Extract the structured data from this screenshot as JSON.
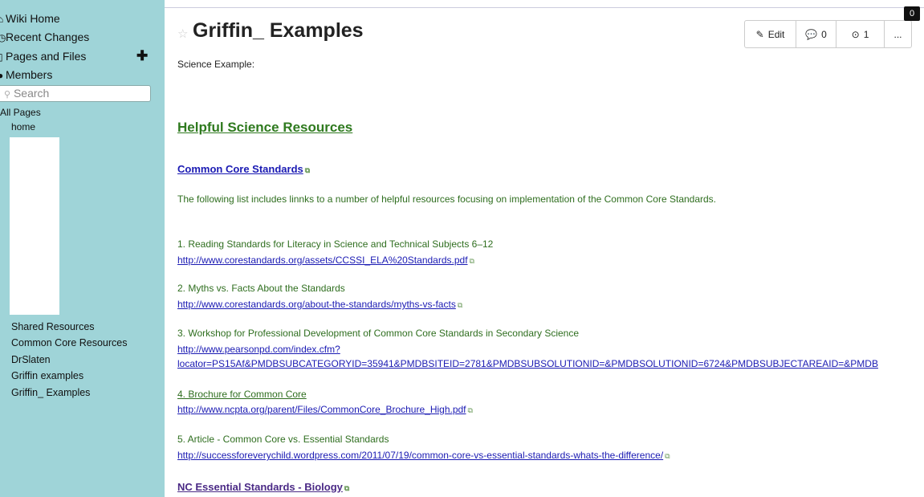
{
  "sidebar": {
    "nav": [
      {
        "label": "Wiki Home",
        "icon": "home-icon"
      },
      {
        "label": "Recent Changes",
        "icon": "clock-icon"
      },
      {
        "label": "Pages and Files",
        "icon": "file-icon"
      },
      {
        "label": "Members",
        "icon": "user-icon"
      }
    ],
    "search_placeholder": "Search",
    "all_pages_label": "All Pages",
    "home_label": "home",
    "pages": [
      "Shared Resources",
      "Common Core Resources",
      "DrSlaten",
      "Griffin examples",
      "Griffin_ Examples"
    ]
  },
  "header": {
    "title": "Griffin_ Examples",
    "edit_label": "Edit",
    "comments_count": "0",
    "revisions_count": "1",
    "more_label": "...",
    "badge_count": "0"
  },
  "content": {
    "science_example": "Science Example:",
    "helpful_heading": "Helpful Science Resources",
    "ccs_heading": "Common Core Standards",
    "intro": "The following list includes linnks to a number of helpful resources focusing on implementation of the Common Core Standards.",
    "resources": [
      {
        "title": "1. Reading Standards for Literacy in Science and Technical Subjects 6–12",
        "url": "http://www.corestandards.org/assets/CCSSI_ELA%20Standards.pdf"
      },
      {
        "title": "2. Myths vs. Facts About the Standards",
        "url": "http://www.corestandards.org/about-the-standards/myths-vs-facts"
      },
      {
        "title": "3. Workshop for Professional Development of Common Core Standards in Secondary Science",
        "url": "http://www.pearsonpd.com/index.cfm?",
        "url2": "locator=PS15Af&PMDBSUBCATEGORYID=35941&PMDBSITEID=2781&PMDBSUBSOLUTIONID=&PMDBSOLUTIONID=6724&PMDBSUBJECTAREAID=&PMDB"
      },
      {
        "title": "4. Brochure for Common Core",
        "url": "http://www.ncpta.org/parent/Files/CommonCore_Brochure_High.pdf"
      },
      {
        "title": "5. Article - Common Core vs. Essential Standards",
        "url": "http://successforeverychild.wordpress.com/2011/07/19/common-core-vs-essential-standards-whats-the-difference/"
      }
    ],
    "nc_heading": "NC Essential Standards - Biology"
  }
}
